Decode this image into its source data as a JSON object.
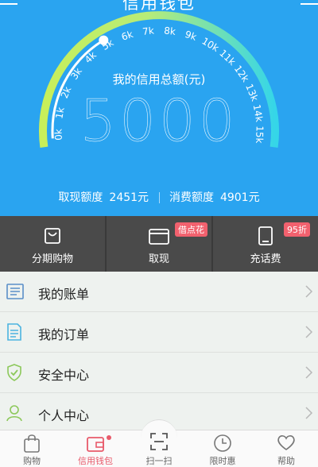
{
  "header": {
    "title": "信用钱包"
  },
  "gauge": {
    "subtitle": "我的信用总额(元)",
    "amount": "5000",
    "min_value": 0,
    "max_value": 15000,
    "current_value": 5000,
    "ticks": [
      "0k",
      "1k",
      "2k",
      "3k",
      "4k",
      "5k",
      "6k",
      "7k",
      "8k",
      "9k",
      "10k",
      "11k",
      "12k",
      "13k",
      "14k",
      "15k"
    ]
  },
  "quota": {
    "cash_label": "取现额度",
    "cash_value": "2451元",
    "consume_label": "消费额度",
    "consume_value": "4901元"
  },
  "actions": [
    {
      "label": "分期购物",
      "icon": "shopping-bag-icon"
    },
    {
      "label": "取现",
      "icon": "card-icon",
      "badge": "借点花"
    },
    {
      "label": "充话费",
      "icon": "phone-icon",
      "badge": "95折"
    }
  ],
  "menu": [
    {
      "label": "我的账单",
      "icon": "receipt-icon"
    },
    {
      "label": "我的订单",
      "icon": "document-icon"
    },
    {
      "label": "安全中心",
      "icon": "shield-check-icon"
    },
    {
      "label": "个人中心",
      "icon": "person-icon"
    }
  ],
  "tabs": [
    {
      "label": "购物",
      "icon": "bag-icon"
    },
    {
      "label": "信用钱包",
      "icon": "wallet-icon",
      "active": true
    },
    {
      "label": "扫一扫",
      "icon": "scan-icon"
    },
    {
      "label": "限时惠",
      "icon": "clock-icon"
    },
    {
      "label": "帮助",
      "icon": "heart-icon"
    }
  ],
  "colors": {
    "hero": "#2aa4f0",
    "actions_bg": "#4a4a4a",
    "accent": "#e85a6b",
    "badge": "#f2616e"
  }
}
